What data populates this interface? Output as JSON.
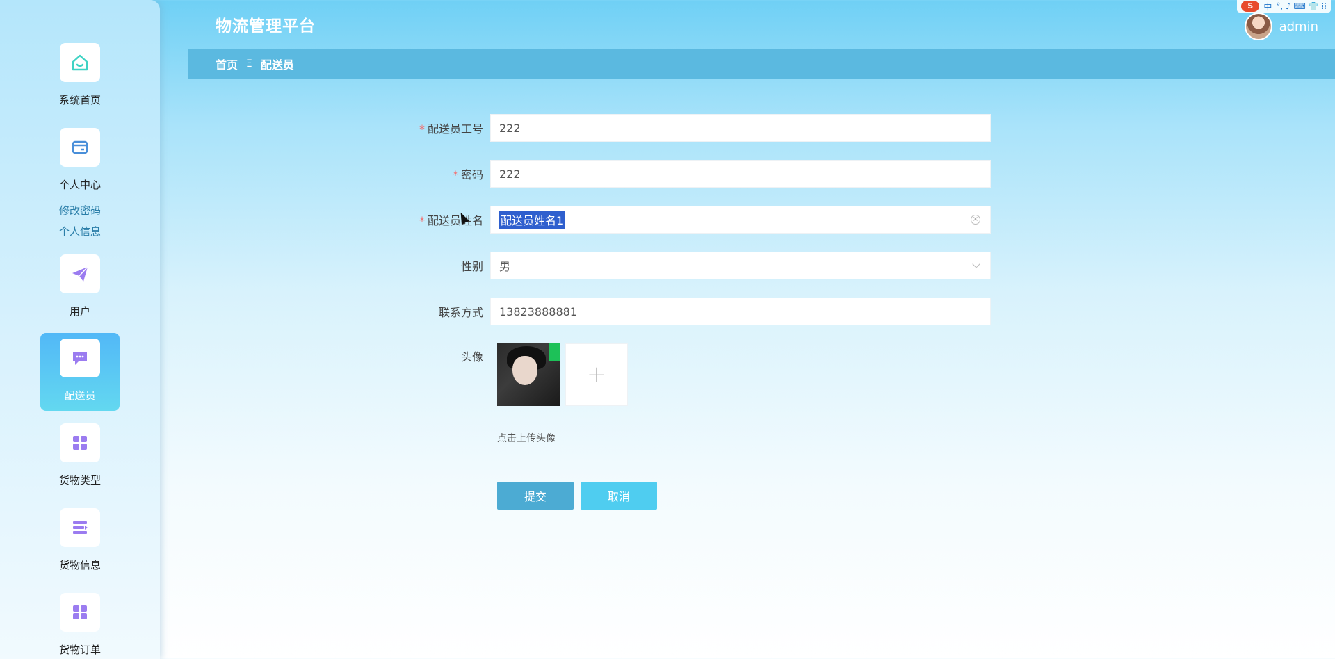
{
  "header": {
    "app_title": "物流管理平台",
    "username": "admin"
  },
  "ime": {
    "logo": "S",
    "lang": "中",
    "extras": "°, ♪ ⌨ 👕 ⁞⁞"
  },
  "breadcrumb": {
    "home": "首页",
    "separator": "Ξ",
    "current": "配送员"
  },
  "sidebar": {
    "items": [
      {
        "label": "系统首页",
        "icon": "home-icon"
      },
      {
        "label": "个人中心",
        "icon": "card-icon"
      },
      {
        "label": "用户",
        "icon": "paper-plane-icon"
      },
      {
        "label": "配送员",
        "icon": "chat-icon",
        "active": true
      },
      {
        "label": "货物类型",
        "icon": "grid-icon"
      },
      {
        "label": "货物信息",
        "icon": "list-icon"
      },
      {
        "label": "货物订单",
        "icon": "grid-icon"
      }
    ],
    "submenu": [
      "修改密码",
      "个人信息"
    ]
  },
  "form": {
    "fields": [
      {
        "label": "配送员工号",
        "required": true,
        "value": "222"
      },
      {
        "label": "密码",
        "required": true,
        "value": "222"
      },
      {
        "label": "配送员姓名",
        "required": true,
        "value": "配送员姓名1"
      },
      {
        "label": "性别",
        "required": false,
        "value": "男"
      },
      {
        "label": "联系方式",
        "required": false,
        "value": "13823888881"
      }
    ],
    "avatar_label": "头像",
    "upload_add": "+",
    "upload_hint": "点击上传头像",
    "required_mark": "*",
    "submit_label": "提交",
    "cancel_label": "取消",
    "clear_icon": "×"
  }
}
